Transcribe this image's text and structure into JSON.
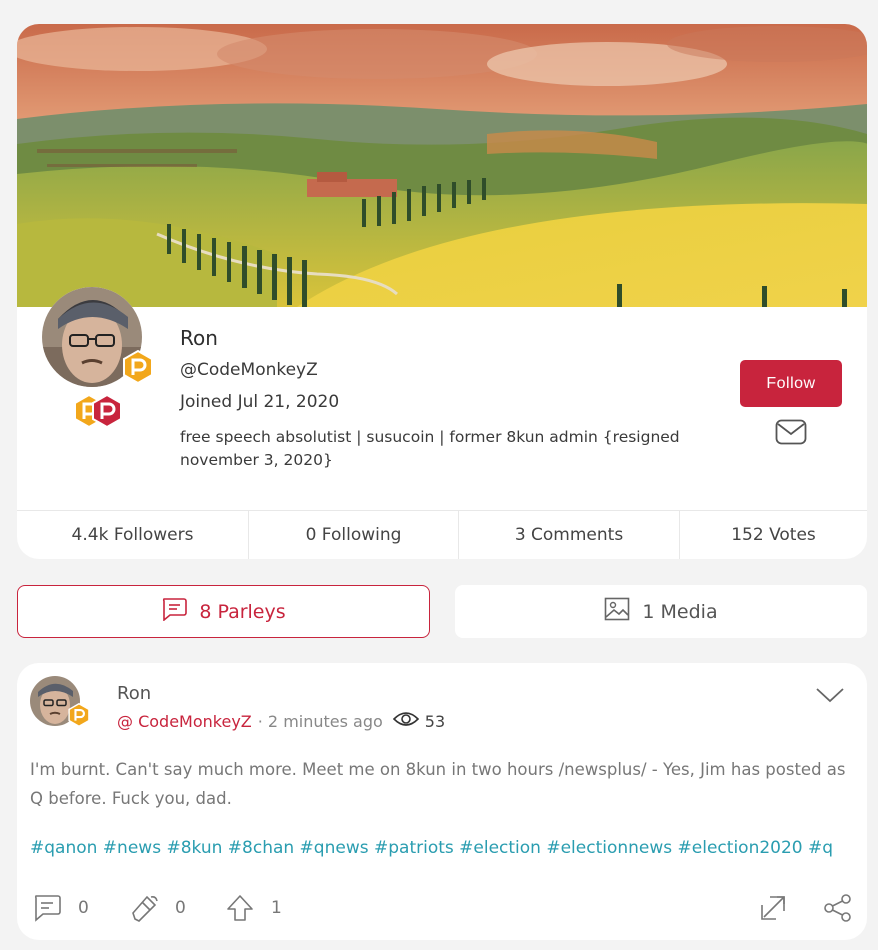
{
  "profile": {
    "name": "Ron",
    "handle": "@CodeMonkeyZ",
    "joined": "Joined Jul 21, 2020",
    "bio": "free speech absolutist | susucoin | former 8kun admin {resigned november 3, 2020}",
    "follow_label": "Follow"
  },
  "stats": [
    {
      "label": "4.4k Followers"
    },
    {
      "label": "0 Following"
    },
    {
      "label": "3 Comments"
    },
    {
      "label": "152 Votes"
    }
  ],
  "tabs": {
    "parleys": "8 Parleys",
    "media": "1 Media"
  },
  "post": {
    "author": "Ron",
    "handle": "@ CodeMonkeyZ",
    "time": "· 2 minutes ago",
    "views": "53",
    "text": "I'm burnt. Can't say much more. Meet me on 8kun in two hours /newsplus/ - Yes, Jim has posted as Q before. Fuck you, dad.",
    "tags": "#qanon #news #8kun #8chan #qnews #patriots #election #electionnews #election2020 #q",
    "comments": "0",
    "echoes": "0",
    "upvotes": "1"
  },
  "colors": {
    "accent": "#c8243d",
    "hashtag": "#2a9db0",
    "badge_gold": "#f2a71b"
  },
  "icons": [
    "envelope-icon",
    "comment-icon",
    "image-icon",
    "eye-icon",
    "chevron-down-icon",
    "echo-icon",
    "upvote-icon",
    "repost-icon",
    "share-icon",
    "verified-badge-icon",
    "parler-badge-icon"
  ]
}
